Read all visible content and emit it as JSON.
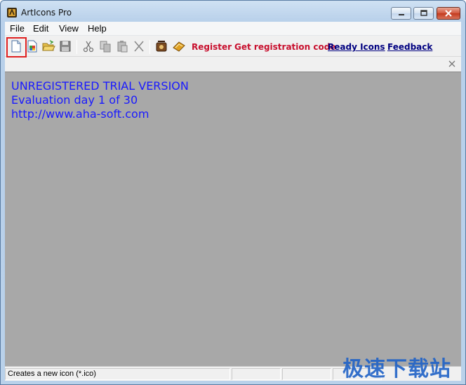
{
  "window": {
    "title": "ArtIcons Pro"
  },
  "menu": {
    "items": [
      "File",
      "Edit",
      "View",
      "Help"
    ]
  },
  "toolbar": {
    "links": {
      "register": "Register",
      "get_code": "Get registration code",
      "ready_icons": "Ready Icons",
      "feedback": "Feedback"
    }
  },
  "workspace": {
    "lines": [
      "UNREGISTERED TRIAL VERSION",
      "Evaluation day 1 of 30",
      "http://www.aha-soft.com"
    ]
  },
  "status": {
    "text": "Creates a new icon (*.ico)"
  },
  "watermark": {
    "text": "极速下载站"
  },
  "colors": {
    "workspace_bg": "#a8a8a8",
    "trial_text": "#1a1aff",
    "register_link": "#c8102e",
    "nav_link": "#000080",
    "highlight_border": "#e02020"
  }
}
